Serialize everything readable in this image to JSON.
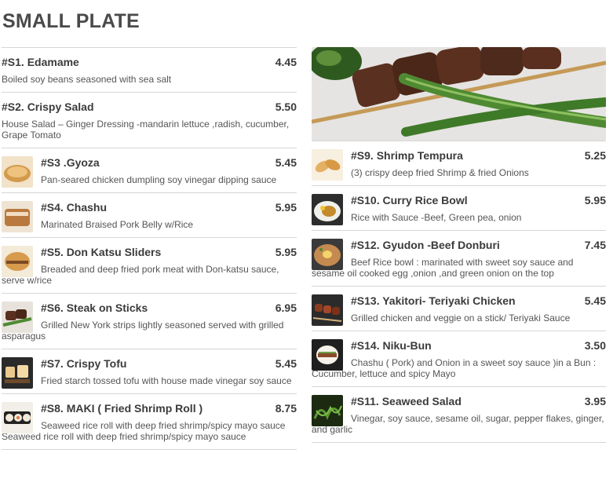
{
  "page": {
    "title": "SMALL PLATE"
  },
  "menu": {
    "left": [
      {
        "name": "#S1. Edamame",
        "price": "4.45",
        "desc": "Boiled soy beans seasoned with sea salt",
        "image": ""
      },
      {
        "name": "#S2. Crispy Salad",
        "price": "5.50",
        "desc": "House Salad – Ginger Dressing -mandarin lettuce ,radish, cucumber, Grape Tomato",
        "image": ""
      },
      {
        "name": "#S3 .Gyoza",
        "price": "5.45",
        "desc": "Pan-seared chicken dumpling soy vinegar dipping sauce",
        "image": "gyoza-photo"
      },
      {
        "name": "#S4. Chashu",
        "price": "5.95",
        "desc": "Marinated Braised Pork Belly w/Rice",
        "image": "chashu-photo"
      },
      {
        "name": "#S5. Don Katsu Sliders",
        "price": "5.95",
        "desc": "Breaded and deep fried pork meat with Don-katsu sauce, serve w/rice",
        "image": "sliders-photo"
      },
      {
        "name": "#S6. Steak on Sticks",
        "price": "6.95",
        "desc": "Grilled New York strips lightly seasoned served with grilled asparagus",
        "image": "steak-photo"
      },
      {
        "name": "#S7. Crispy Tofu",
        "price": "5.45",
        "desc": "Fried starch tossed tofu with house made vinegar soy sauce",
        "image": "tofu-photo"
      },
      {
        "name": "#S8. MAKI ( Fried Shrimp Roll )",
        "price": "8.75",
        "desc": "Seaweed rice roll with deep fried shrimp/spicy mayo sauce Seaweed rice roll with deep fried shrimp/spicy mayo sauce",
        "image": "maki-photo"
      }
    ],
    "right": [
      {
        "name": "#S9. Shrimp Tempura",
        "price": "5.25",
        "desc": "(3) crispy deep fried Shrimp & fried Onions",
        "image": "tempura-photo"
      },
      {
        "name": "#S10. Curry Rice Bowl",
        "price": "5.95",
        "desc": "Rice with Sauce -Beef, Green pea, onion",
        "image": "curry-photo"
      },
      {
        "name": "#S12. Gyudon -Beef Donburi",
        "price": "7.45",
        "desc": "Beef Rice bowl : marinated with sweet soy sauce and sesame oil cooked egg ,onion ,and green onion on the top",
        "image": "gyudon-photo"
      },
      {
        "name": "#S13. Yakitori- Teriyaki Chicken",
        "price": "5.45",
        "desc": "Grilled chicken and veggie on a stick/ Teriyaki Sauce",
        "image": "yakitori-photo"
      },
      {
        "name": "#S14. Niku-Bun",
        "price": "3.50",
        "desc": "Chashu ( Pork) and Onion in a sweet soy sauce )in a Bun : Cucumber, lettuce and spicy Mayo",
        "image": "bun-photo"
      },
      {
        "name": "#S11. Seaweed Salad",
        "price": "3.95",
        "desc": "Vinegar, soy sauce, sesame oil, sugar, pepper flakes, ginger, and garlic",
        "image": "seaweed-photo"
      }
    ]
  }
}
